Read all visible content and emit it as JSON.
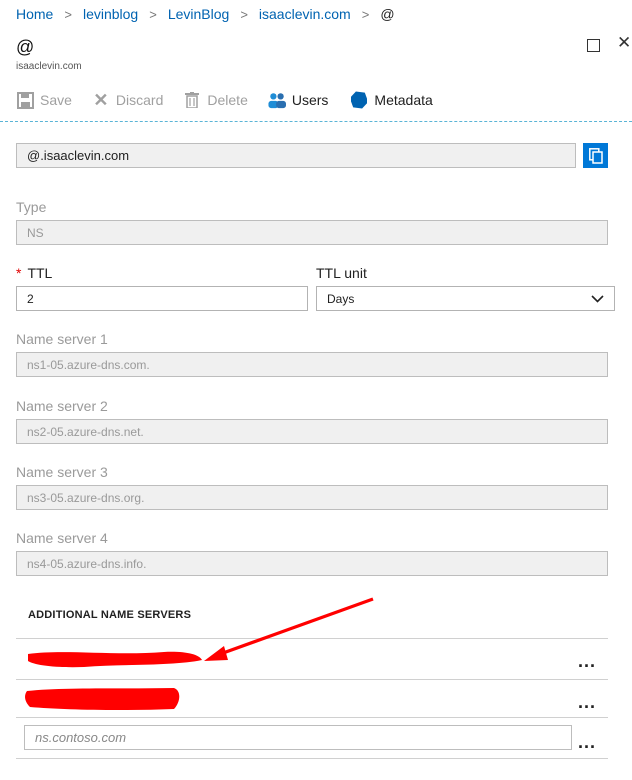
{
  "breadcrumb": {
    "items": [
      "Home",
      "levinblog",
      "LevinBlog",
      "isaaclevin.com",
      "@"
    ]
  },
  "header": {
    "title": "@",
    "subtitle": "isaaclevin.com"
  },
  "toolbar": {
    "save": "Save",
    "discard": "Discard",
    "delete": "Delete",
    "users": "Users",
    "metadata": "Metadata"
  },
  "record_name": "@.isaaclevin.com",
  "type": {
    "label": "Type",
    "value": "NS"
  },
  "ttl": {
    "label": "TTL",
    "value": "2",
    "required_marker": "*"
  },
  "ttl_unit": {
    "label": "TTL unit",
    "value": "Days"
  },
  "name_servers": [
    {
      "label": "Name server 1",
      "value": "ns1-05.azure-dns.com."
    },
    {
      "label": "Name server 2",
      "value": "ns2-05.azure-dns.net."
    },
    {
      "label": "Name server 3",
      "value": "ns3-05.azure-dns.org."
    },
    {
      "label": "Name server 4",
      "value": "ns4-05.azure-dns.info."
    }
  ],
  "additional": {
    "heading": "ADDITIONAL NAME SERVERS",
    "more_label": "...",
    "new_placeholder": "ns.contoso.com"
  },
  "colors": {
    "link": "#0063b1",
    "accent": "#0078d7",
    "redaction": "#ff0000"
  }
}
